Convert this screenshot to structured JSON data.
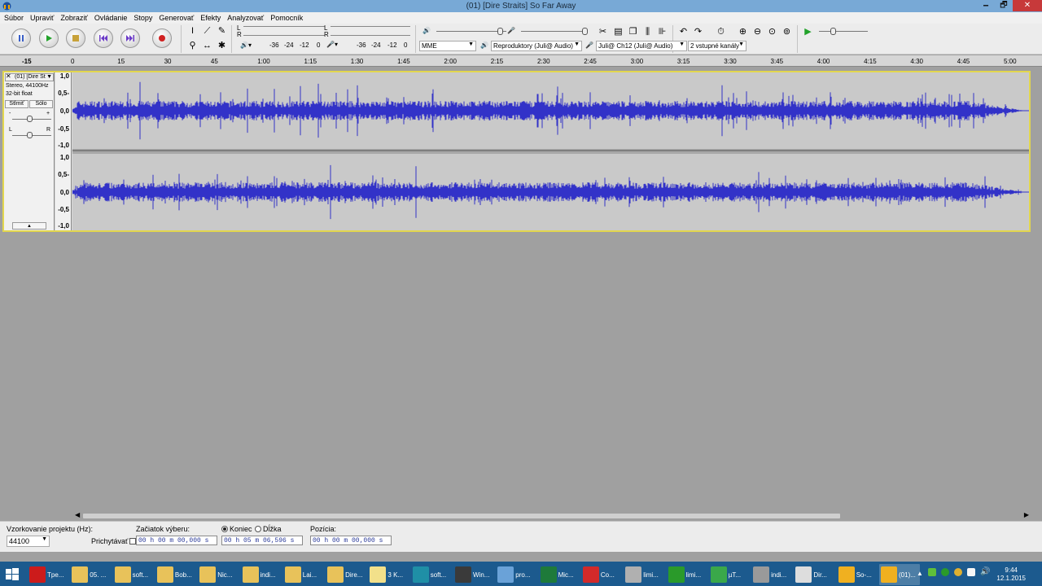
{
  "window": {
    "title": "(01) [Dire Straits] So Far Away",
    "minimize": "🗕",
    "maximize": "🗗",
    "close": "✕"
  },
  "menu": [
    "Súbor",
    "Upraviť",
    "Zobraziť",
    "Ovládanie",
    "Stopy",
    "Generovať",
    "Efekty",
    "Analyzovať",
    "Pomocník"
  ],
  "meters": {
    "playback_ticks": [
      "-36",
      "-24",
      "-12",
      "0"
    ],
    "record_ticks": [
      "-36",
      "-24",
      "-12",
      "0"
    ],
    "lr_left": "L",
    "lr_right": "R"
  },
  "devices": {
    "host": "MME",
    "output": "Reproduktory (Juli@ Audio)",
    "input": "Juli@ Ch12 (Juli@ Audio)",
    "channels": "2 vstupné kanály"
  },
  "ruler": {
    "ticks": [
      "-15",
      "0",
      "15",
      "30",
      "45",
      "1:00",
      "1:15",
      "1:30",
      "1:45",
      "2:00",
      "2:15",
      "2:30",
      "2:45",
      "3:00",
      "3:15",
      "3:30",
      "3:45",
      "4:00",
      "4:15",
      "4:30",
      "4:45",
      "5:00"
    ]
  },
  "track": {
    "name": "(01) [Dire St",
    "info_rate": "Stereo, 44100Hz",
    "info_format": "32-bit float",
    "mute_label": "Stlmiť",
    "solo_label": "Sólo",
    "gain_minus": "-",
    "gain_plus": "+",
    "pan_left": "L",
    "pan_right": "R",
    "y_labels": [
      "1,0",
      "0,5-",
      "0,0",
      "-0,5",
      "-1,0"
    ],
    "wave_color": "#3232c8"
  },
  "selection_bar": {
    "rate_label": "Vzorkovanie projektu (Hz):",
    "rate_value": "44100",
    "snap_label": "Prichytávať",
    "start_label": "Začiatok výberu:",
    "end_label": "Koniec",
    "length_label": "Dĺžka",
    "position_label": "Pozícia:",
    "start_value": "00 h 00 m 00,000 s",
    "end_value": "00 h 05 m 06,596 s",
    "position_value": "00 h 00 m 00,000 s"
  },
  "taskbar": {
    "items": [
      {
        "label": "Tpe...",
        "color": "#cc1b1b"
      },
      {
        "label": "05. ...",
        "color": "#e8c25a"
      },
      {
        "label": "soft...",
        "color": "#e8c25a"
      },
      {
        "label": "Bob...",
        "color": "#e8c25a"
      },
      {
        "label": "Nic...",
        "color": "#e8c25a"
      },
      {
        "label": "indi...",
        "color": "#e8c25a"
      },
      {
        "label": "Lai...",
        "color": "#e8c25a"
      },
      {
        "label": "Dire...",
        "color": "#e8c25a"
      },
      {
        "label": "3 K...",
        "color": "#f2e08a"
      },
      {
        "label": "soft...",
        "color": "#1f8fa6"
      },
      {
        "label": "Win...",
        "color": "#3a3a3a"
      },
      {
        "label": "pro...",
        "color": "#6aa2d8"
      },
      {
        "label": "Mic...",
        "color": "#1e7a3a"
      },
      {
        "label": "Co...",
        "color": "#d22a2a"
      },
      {
        "label": "limi...",
        "color": "#b0b0b0"
      },
      {
        "label": "limi...",
        "color": "#2a9a2a"
      },
      {
        "label": "µT...",
        "color": "#3aa84a"
      },
      {
        "label": "indi...",
        "color": "#9a9a9a"
      },
      {
        "label": "Dir...",
        "color": "#dddddd"
      },
      {
        "label": "So-...",
        "color": "#f0b020"
      },
      {
        "label": "(01)...",
        "color": "#f0b020"
      }
    ],
    "time": "9:44",
    "date": "12.1.2015"
  }
}
